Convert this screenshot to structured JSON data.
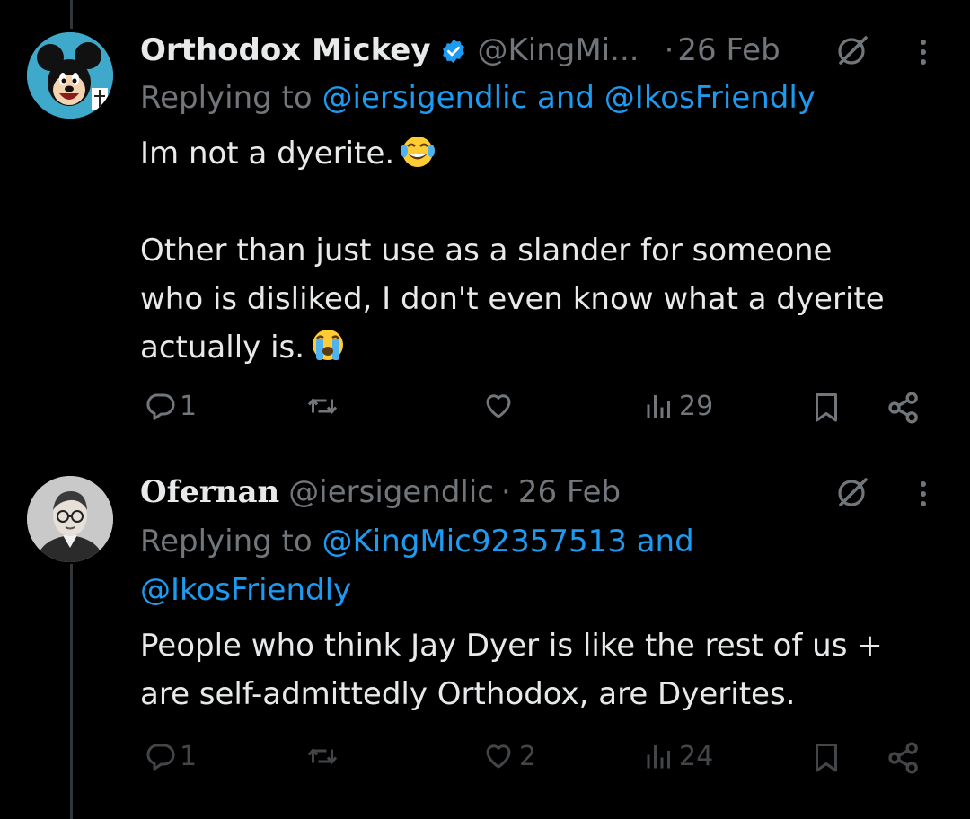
{
  "tweets": [
    {
      "author": "Orthodox Mickey",
      "handle": "@KingMi...",
      "separator": "·",
      "date": "26 Feb",
      "replying_label": "Replying to",
      "reply_targets": "@iersigendlic and @IkosFriendly",
      "paragraphs": [
        "Im not a dyerite.",
        "Other than just use as a slander for someone",
        "who is disliked, I don't even know what a dyerite",
        "actually is."
      ],
      "emojis": [
        "face-with-tears-of-joy",
        "loudly-crying-face"
      ],
      "replies": "1",
      "reposts": "",
      "likes": "",
      "views": "29"
    },
    {
      "author": "Ofernan",
      "handle": "@iersigendlic",
      "separator": "·",
      "date": "26 Feb",
      "replying_label": "Replying to",
      "reply_targets_line1": "@KingMic92357513 and",
      "reply_targets_line2": "@IkosFriendly",
      "paragraphs": [
        "People who think Jay Dyer is like the rest of us +",
        "are self-admittedly Orthodox, are Dyerites."
      ],
      "replies": "1",
      "reposts": "",
      "likes": "2",
      "views": "24"
    }
  ],
  "colors": {
    "background": "#000000",
    "text": "#e7e9ea",
    "muted": "#71767b",
    "link": "#1d9bf0",
    "verified": "#1d9bf0"
  }
}
